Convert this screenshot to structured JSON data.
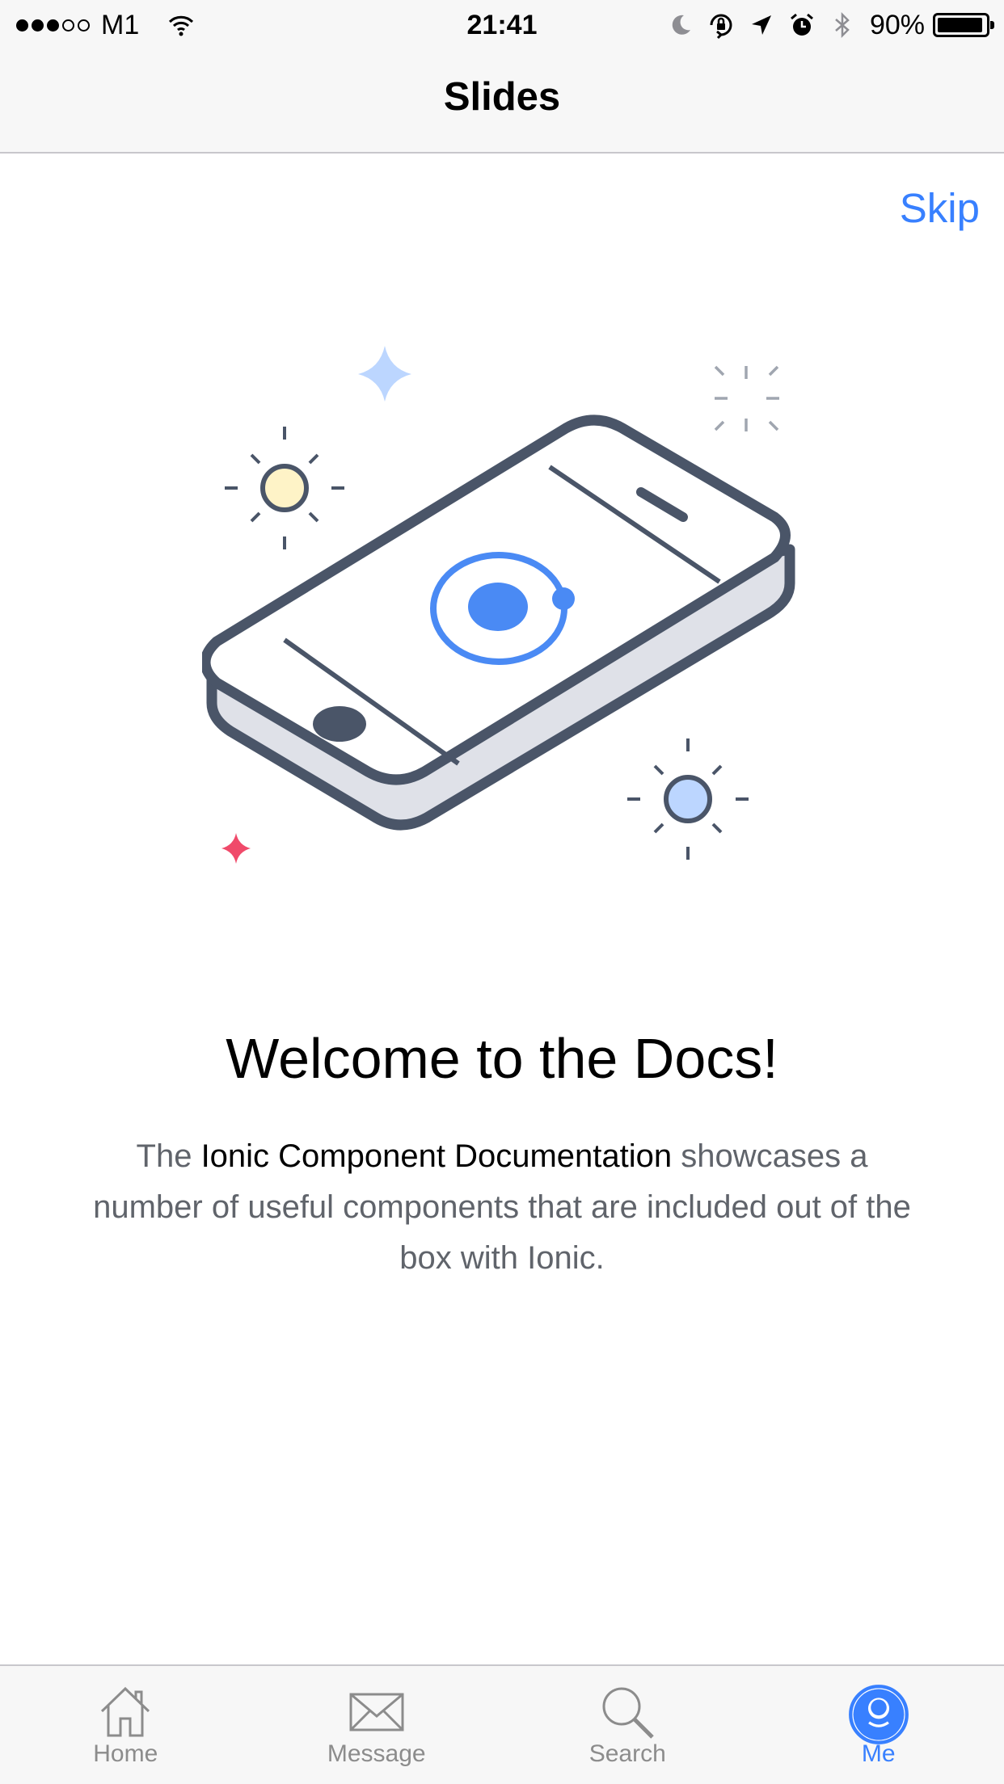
{
  "status_bar": {
    "carrier": "M1",
    "time": "21:41",
    "battery": "90%",
    "signal_bars_filled": 3,
    "signal_bars_total": 5,
    "icons": [
      "wifi-icon",
      "moon-icon",
      "orientation-lock-icon",
      "location-arrow-icon",
      "alarm-icon",
      "bluetooth-icon",
      "battery-icon"
    ]
  },
  "nav": {
    "title": "Slides"
  },
  "slide": {
    "skip_label": "Skip",
    "title": "Welcome to the Docs!",
    "text_before": "The ",
    "text_bold": "Ionic Component Documentation",
    "text_after": " showcases a number of useful components that are included out of the box with Ionic.",
    "illustration": "phone-illustration"
  },
  "tabs": [
    {
      "label": "Home",
      "icon": "home-icon",
      "active": false
    },
    {
      "label": "Message",
      "icon": "envelope-icon",
      "active": false
    },
    {
      "label": "Search",
      "icon": "search-icon",
      "active": false
    },
    {
      "label": "Me",
      "icon": "person-icon",
      "active": true
    }
  ],
  "colors": {
    "accent": "#3880ff",
    "bar_background": "#f7f7f7",
    "inactive_tab": "#8c8c8c",
    "body_text": "#60646b"
  }
}
